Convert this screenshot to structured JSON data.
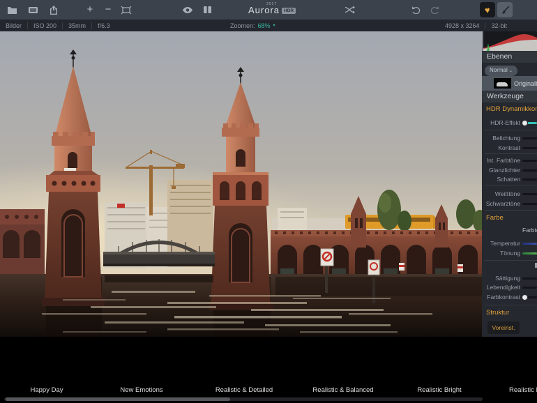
{
  "app": {
    "logo_year": "2017",
    "logo_name": "Aurora",
    "logo_badge": "HDR"
  },
  "infobar": {
    "items_left": [
      "Bilder",
      "ISO 200",
      "35mm",
      "f/6.3"
    ],
    "zoom_label": "Zoomen:",
    "zoom_value": "68%",
    "zoom_caret": "▾",
    "items_right": [
      "4928 x 3264",
      "32-bit"
    ]
  },
  "layers": {
    "header": "Ebenen",
    "blend_mode": "Normal",
    "blend_caret": "⌄",
    "layer_name": "Originalbild"
  },
  "tools": {
    "header": "Werkzeuge",
    "hdr": {
      "title": "HDR Dynamikkompressor",
      "rows": [
        "HDR-Effekt",
        "Belichtung",
        "Kontrast",
        "Int. Farbtöne",
        "Glanzlichter",
        "Schatten",
        "Weißtöne",
        "Schwarztöne"
      ]
    },
    "color": {
      "title": "Farbe",
      "sub1": "Farbtemperatur",
      "rows": [
        "Temperatur",
        "Tönung",
        "Sättigung",
        "Lebendigkeit",
        "Farbkontrast"
      ]
    },
    "structure": {
      "title": "Struktur"
    },
    "preset_button": "Voreinst."
  },
  "presets": {
    "items": [
      "Happy Day",
      "New Emotions",
      "Realistic & Detailed",
      "Realistic & Balanced",
      "Realistic Bright",
      "Realistic D"
    ]
  },
  "colors": {
    "accent_teal": "#3ab5a5",
    "accent_orange": "#e2a23c",
    "toolbar_bg": "#3b424b",
    "sidebar_bg": "#25282e"
  }
}
